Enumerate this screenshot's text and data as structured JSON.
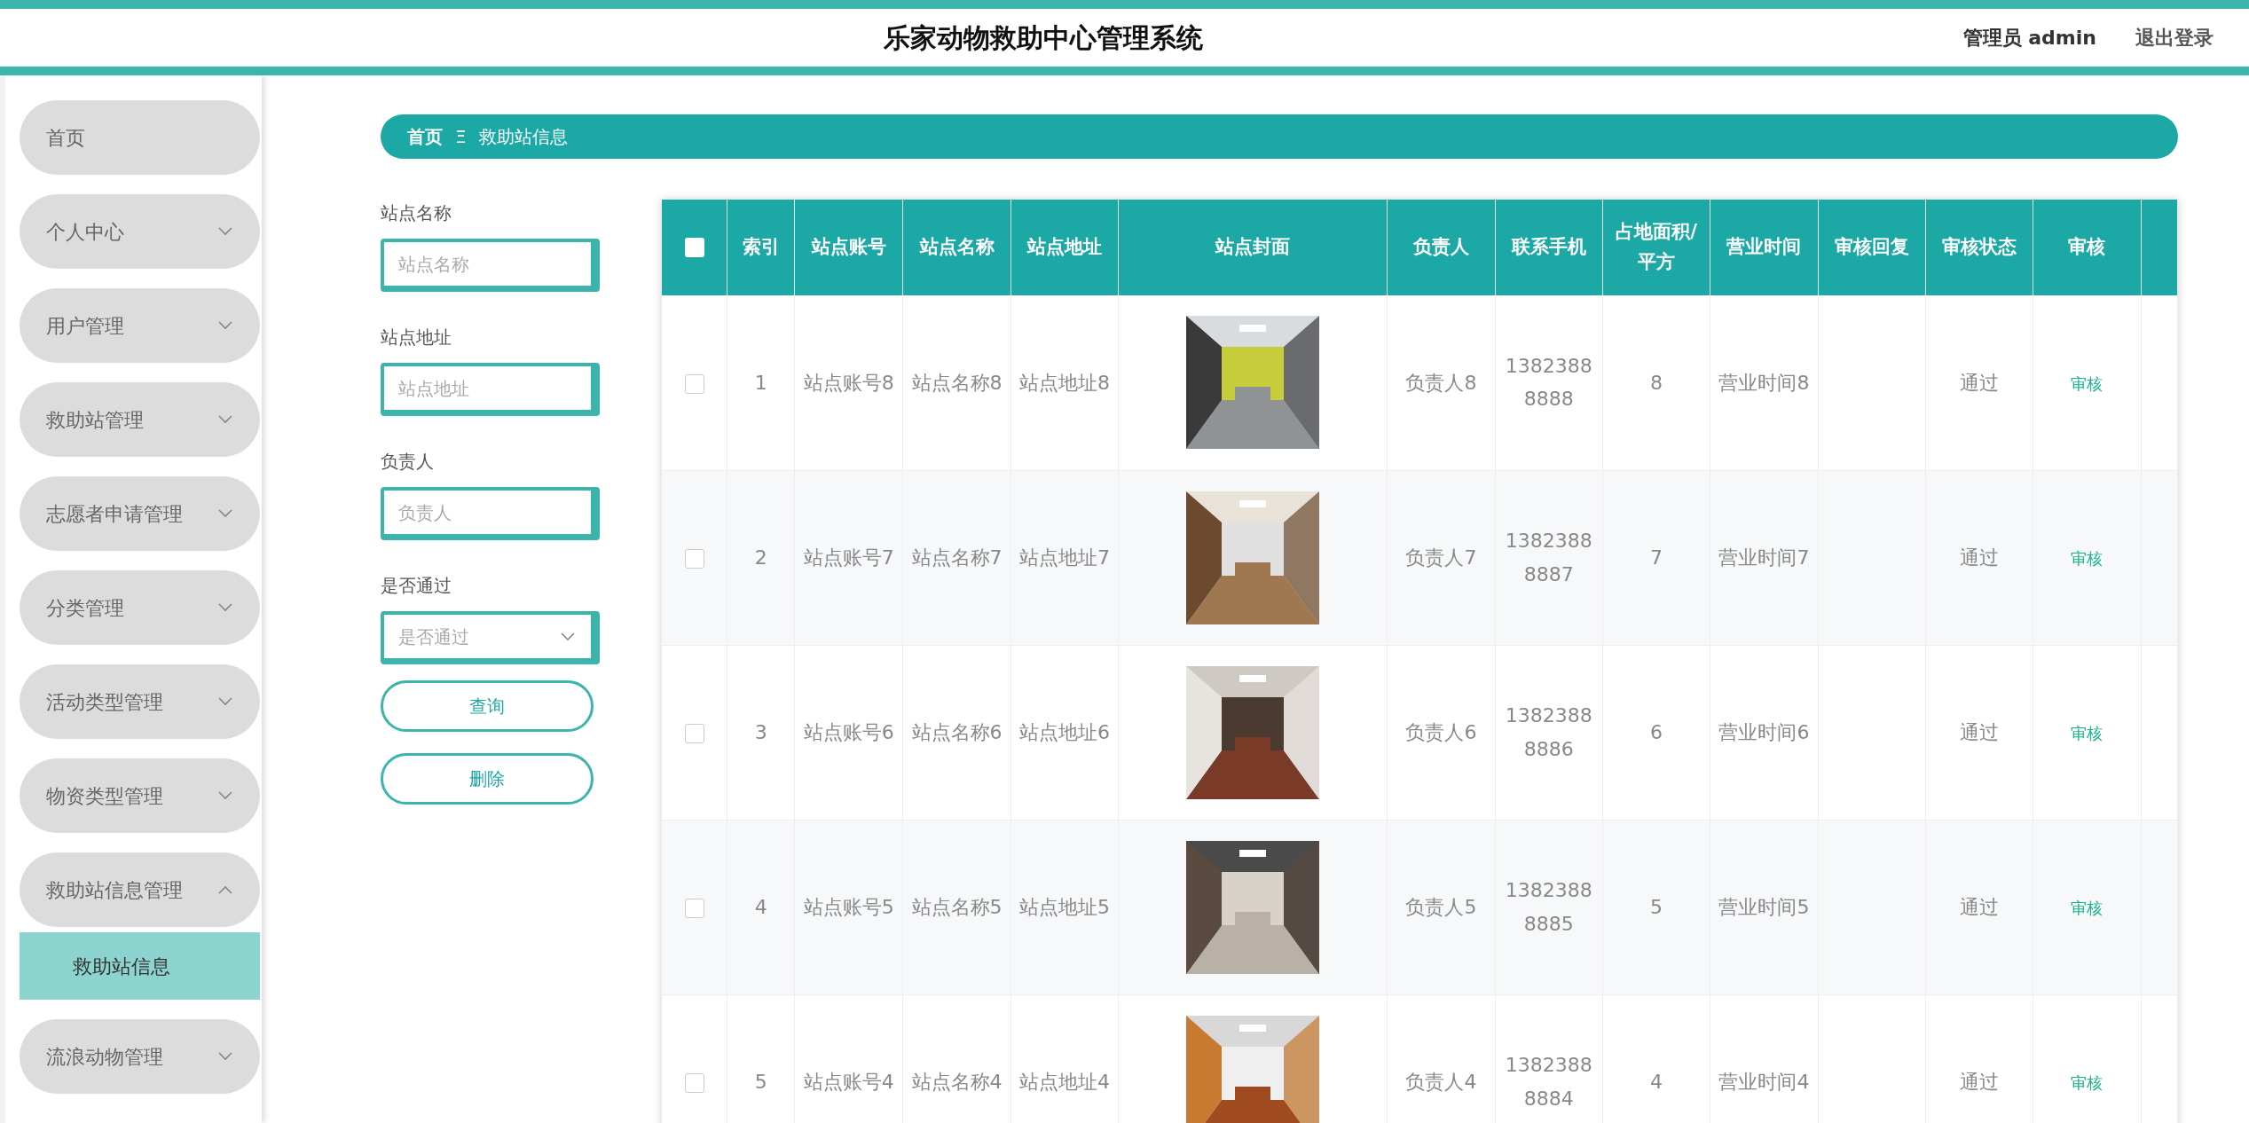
{
  "header": {
    "title": "乐家动物救助中心管理系统",
    "user": "管理员 admin",
    "logout": "退出登录"
  },
  "sidebar": {
    "items": [
      {
        "label": "首页"
      },
      {
        "label": "个人中心",
        "expandable": true,
        "expanded": false
      },
      {
        "label": "用户管理",
        "expandable": true,
        "expanded": false
      },
      {
        "label": "救助站管理",
        "expandable": true,
        "expanded": false
      },
      {
        "label": "志愿者申请管理",
        "expandable": true,
        "expanded": false
      },
      {
        "label": "分类管理",
        "expandable": true,
        "expanded": false
      },
      {
        "label": "活动类型管理",
        "expandable": true,
        "expanded": false
      },
      {
        "label": "物资类型管理",
        "expandable": true,
        "expanded": false
      },
      {
        "label": "救助站信息管理",
        "expandable": true,
        "expanded": true,
        "children": [
          {
            "label": "救助站信息",
            "selected": true
          }
        ]
      },
      {
        "label": "流浪动物管理",
        "expandable": true,
        "expanded": false
      }
    ]
  },
  "breadcrumb": {
    "home": "首页",
    "separator": "Ξ",
    "current": "救助站信息"
  },
  "search": {
    "fields": [
      {
        "kind": "text",
        "label": "站点名称",
        "placeholder": "站点名称"
      },
      {
        "kind": "text",
        "label": "站点地址",
        "placeholder": "站点地址"
      },
      {
        "kind": "text",
        "label": "负责人",
        "placeholder": "负责人"
      },
      {
        "kind": "select",
        "label": "是否通过",
        "placeholder": "是否通过"
      }
    ],
    "buttons": [
      "查询",
      "删除"
    ]
  },
  "table": {
    "select_all_checked": false,
    "columns": [
      "索引",
      "站点账号",
      "站点名称",
      "站点地址",
      "站点封面",
      "负责人",
      "联系手机",
      "占地面积/平方",
      "营业时间",
      "审核回复",
      "审核状态",
      "审核"
    ],
    "rows": [
      {
        "checked": false,
        "cells": [
          "1",
          "站点账号8",
          "站点名称8",
          "站点地址8",
          "",
          "负责人8",
          "13823888888",
          "8",
          "营业时间8",
          "",
          "通过",
          "审核"
        ]
      },
      {
        "checked": false,
        "cells": [
          "2",
          "站点账号7",
          "站点名称7",
          "站点地址7",
          "",
          "负责人7",
          "13823888887",
          "7",
          "营业时间7",
          "",
          "通过",
          "审核"
        ]
      },
      {
        "checked": false,
        "cells": [
          "3",
          "站点账号6",
          "站点名称6",
          "站点地址6",
          "",
          "负责人6",
          "13823888886",
          "6",
          "营业时间6",
          "",
          "通过",
          "审核"
        ]
      },
      {
        "checked": false,
        "cells": [
          "4",
          "站点账号5",
          "站点名称5",
          "站点地址5",
          "",
          "负责人5",
          "13823888885",
          "5",
          "营业时间5",
          "",
          "通过",
          "审核"
        ]
      },
      {
        "checked": false,
        "cells": [
          "5",
          "站点账号4",
          "站点名称4",
          "站点地址4",
          "",
          "负责人4",
          "13823888884",
          "4",
          "营业时间4",
          "",
          "通过",
          "审核"
        ]
      }
    ]
  }
}
